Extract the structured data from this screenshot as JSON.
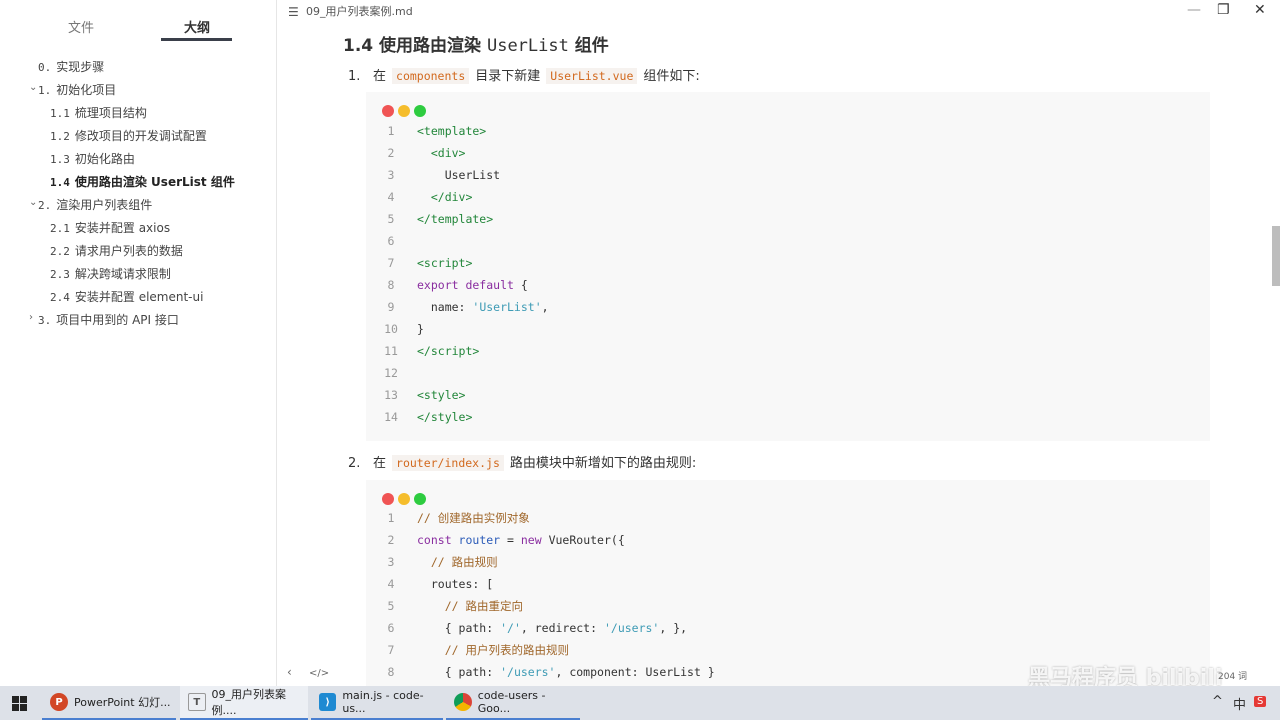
{
  "window": {
    "filename": "09_用户列表案例.md",
    "minimize": "—",
    "restore": "❐",
    "close": "✕"
  },
  "sidebar": {
    "tabs": [
      {
        "label": "文件"
      },
      {
        "label": "大纲"
      }
    ],
    "outline": [
      {
        "num": "0.",
        "label": "实现步骤"
      },
      {
        "num": "1.",
        "label": "初始化项目",
        "caret": "⌄"
      },
      {
        "num": "1.1",
        "label": "梳理项目结构"
      },
      {
        "num": "1.2",
        "label": "修改项目的开发调试配置"
      },
      {
        "num": "1.3",
        "label": "初始化路由"
      },
      {
        "num": "1.4",
        "label": "使用路由渲染 UserList 组件"
      },
      {
        "num": "2.",
        "label": "渲染用户列表组件",
        "caret": "⌄"
      },
      {
        "num": "2.1",
        "label": "安装并配置 axios"
      },
      {
        "num": "2.2",
        "label": "请求用户列表的数据"
      },
      {
        "num": "2.3",
        "label": "解决跨域请求限制"
      },
      {
        "num": "2.4",
        "label": "安装并配置 element-ui"
      },
      {
        "num": "3.",
        "label": "项目中用到的 API 接口",
        "caret": "›"
      }
    ]
  },
  "main": {
    "heading": {
      "num": "1.4",
      "text1": "使用路由渲染",
      "code": "UserList",
      "text2": "组件"
    },
    "step1": {
      "num": "1.",
      "t1": "在",
      "c1": "components",
      "t2": "目录下新建",
      "c2": "UserList.vue",
      "t3": "组件如下:"
    },
    "step2": {
      "num": "2.",
      "t1": "在",
      "c1": "router/index.js",
      "t2": "路由模块中新增如下的路由规则:"
    },
    "code1": [
      [
        [
          "<template>",
          "tag"
        ]
      ],
      [
        [
          "  <div>",
          "tag"
        ]
      ],
      [
        [
          "    UserList",
          "plain"
        ]
      ],
      [
        [
          "  </div>",
          "tag"
        ]
      ],
      [
        [
          "</template>",
          "tag"
        ]
      ],
      [],
      [
        [
          "<script>",
          "tag"
        ]
      ],
      [
        [
          "export default",
          "kw"
        ],
        [
          " {",
          "plain"
        ]
      ],
      [
        [
          "  name: ",
          "plain"
        ],
        [
          "'UserList'",
          "str"
        ],
        [
          ",",
          "plain"
        ]
      ],
      [
        [
          "}",
          "plain"
        ]
      ],
      [
        [
          "</script>",
          "tag"
        ]
      ],
      [],
      [
        [
          "<style>",
          "tag"
        ]
      ],
      [
        [
          "</style>",
          "tag"
        ]
      ]
    ],
    "code2": [
      [
        [
          "// 创建路由实例对象",
          "com"
        ]
      ],
      [
        [
          "const",
          "kw"
        ],
        [
          " router",
          "var"
        ],
        [
          " = ",
          "plain"
        ],
        [
          "new",
          "kw"
        ],
        [
          " VueRouter({",
          "plain"
        ]
      ],
      [
        [
          "  // 路由规则",
          "com"
        ]
      ],
      [
        [
          "  routes: [",
          "plain"
        ]
      ],
      [
        [
          "    // 路由重定向",
          "com"
        ]
      ],
      [
        [
          "    { path: ",
          "plain"
        ],
        [
          "'/'",
          "str"
        ],
        [
          ", redirect: ",
          "plain"
        ],
        [
          "'/users'",
          "str"
        ],
        [
          ", },",
          "plain"
        ]
      ],
      [
        [
          "    // 用户列表的路由规则",
          "com"
        ]
      ],
      [
        [
          "    { path: ",
          "plain"
        ],
        [
          "'/users'",
          "str"
        ],
        [
          ", component: UserList }",
          "plain"
        ]
      ]
    ],
    "bottom": {
      "back": "‹",
      "source": "</>",
      "word_count": "204 词"
    },
    "watermark": "黑马程序员 bilibili"
  },
  "colors": {
    "red": "#f05454",
    "yellow": "#f5bd2c",
    "green": "#2ecc40"
  },
  "taskbar": {
    "items": [
      {
        "label": "PowerPoint 幻灯...",
        "icon": "P"
      },
      {
        "label": "09_用户列表案例....",
        "icon": "T"
      },
      {
        "label": "main.js - code-us...",
        "icon": "⟩"
      },
      {
        "label": "code-users - Goo...",
        "icon": ""
      }
    ],
    "tray": {
      "chevron": "^",
      "ime": "中",
      "sogou": "S"
    }
  }
}
